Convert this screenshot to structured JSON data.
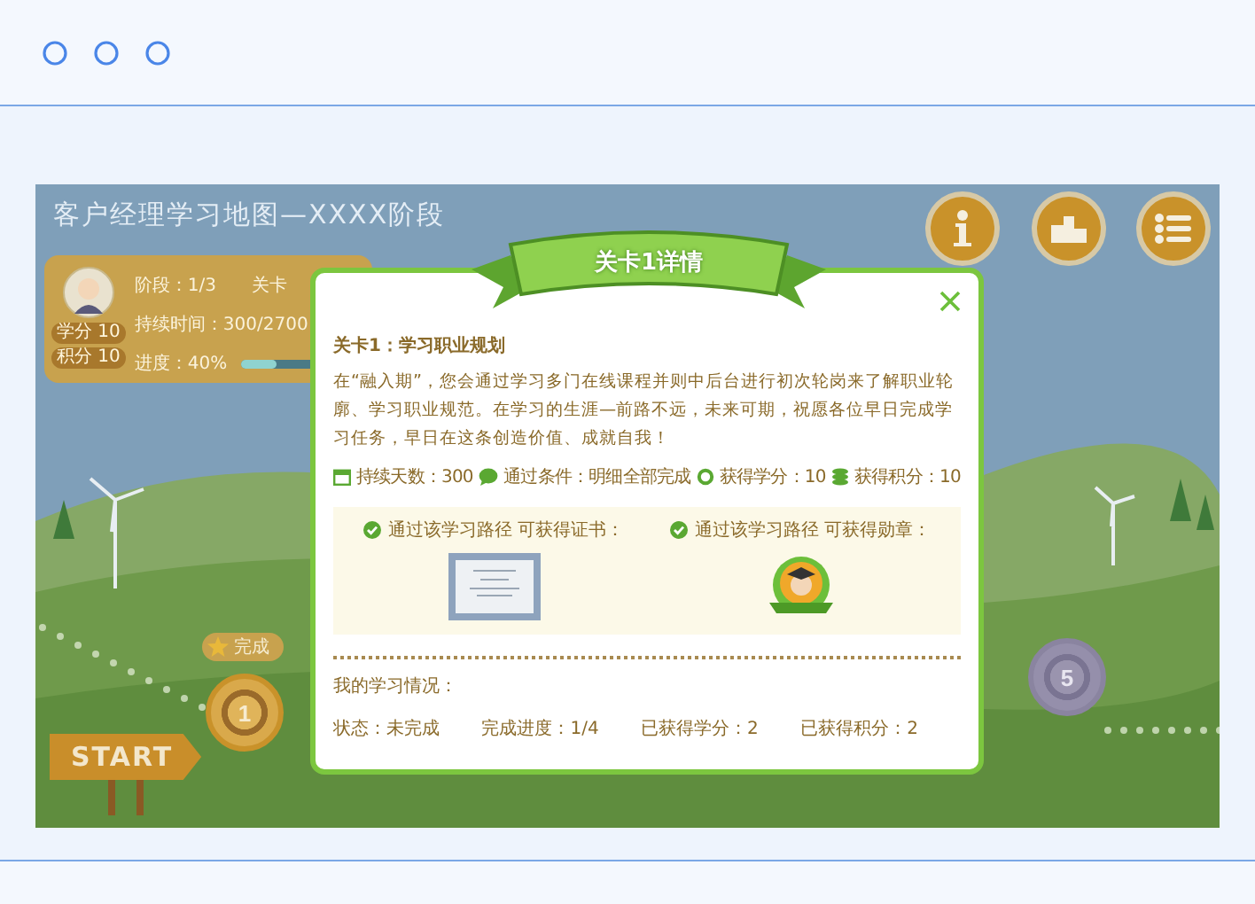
{
  "map": {
    "title": "客户经理学习地图—XXXX阶段",
    "profile": {
      "stage": "阶段：1/3",
      "level_label": "关卡",
      "duration": "持续时间：300/2700",
      "progress": "进度：40%",
      "level": 0.4,
      "credits": "学分 10",
      "points": "积分 10"
    },
    "nodes": [
      {
        "label": "1",
        "kind": "done",
        "tag": "完成"
      },
      {
        "label": "5",
        "kind": "locked"
      }
    ],
    "start": "START"
  },
  "dialog": {
    "title": "关卡1详情",
    "heading": "关卡1：学习职业规划",
    "description": "在“融入期”，您会通过学习多门在线课程并则中后台进行初次轮岗来了解职业轮廓、学习职业规范。在学习的生涯—前路不远，未来可期，祝愿各位早日完成学习任务，早日在这条创造价值、成就自我！",
    "stats": [
      {
        "kind": "days",
        "text": "持续天数：300"
      },
      {
        "kind": "condition",
        "text": "通过条件：明细全部完成"
      },
      {
        "kind": "credits",
        "text": "获得学分：10"
      },
      {
        "kind": "points",
        "text": "获得积分：10"
      }
    ],
    "rewards": [
      {
        "kind": "certificate",
        "label": "通过该学习路径 可获得证书："
      },
      {
        "kind": "medal",
        "label": "通过该学习路径 可获得勋章："
      }
    ],
    "my_study": {
      "title": "我的学习情况：",
      "items": [
        "状态：未完成",
        "完成进度：1/4",
        "已获得学分：2",
        "已获得积分：2"
      ]
    }
  }
}
